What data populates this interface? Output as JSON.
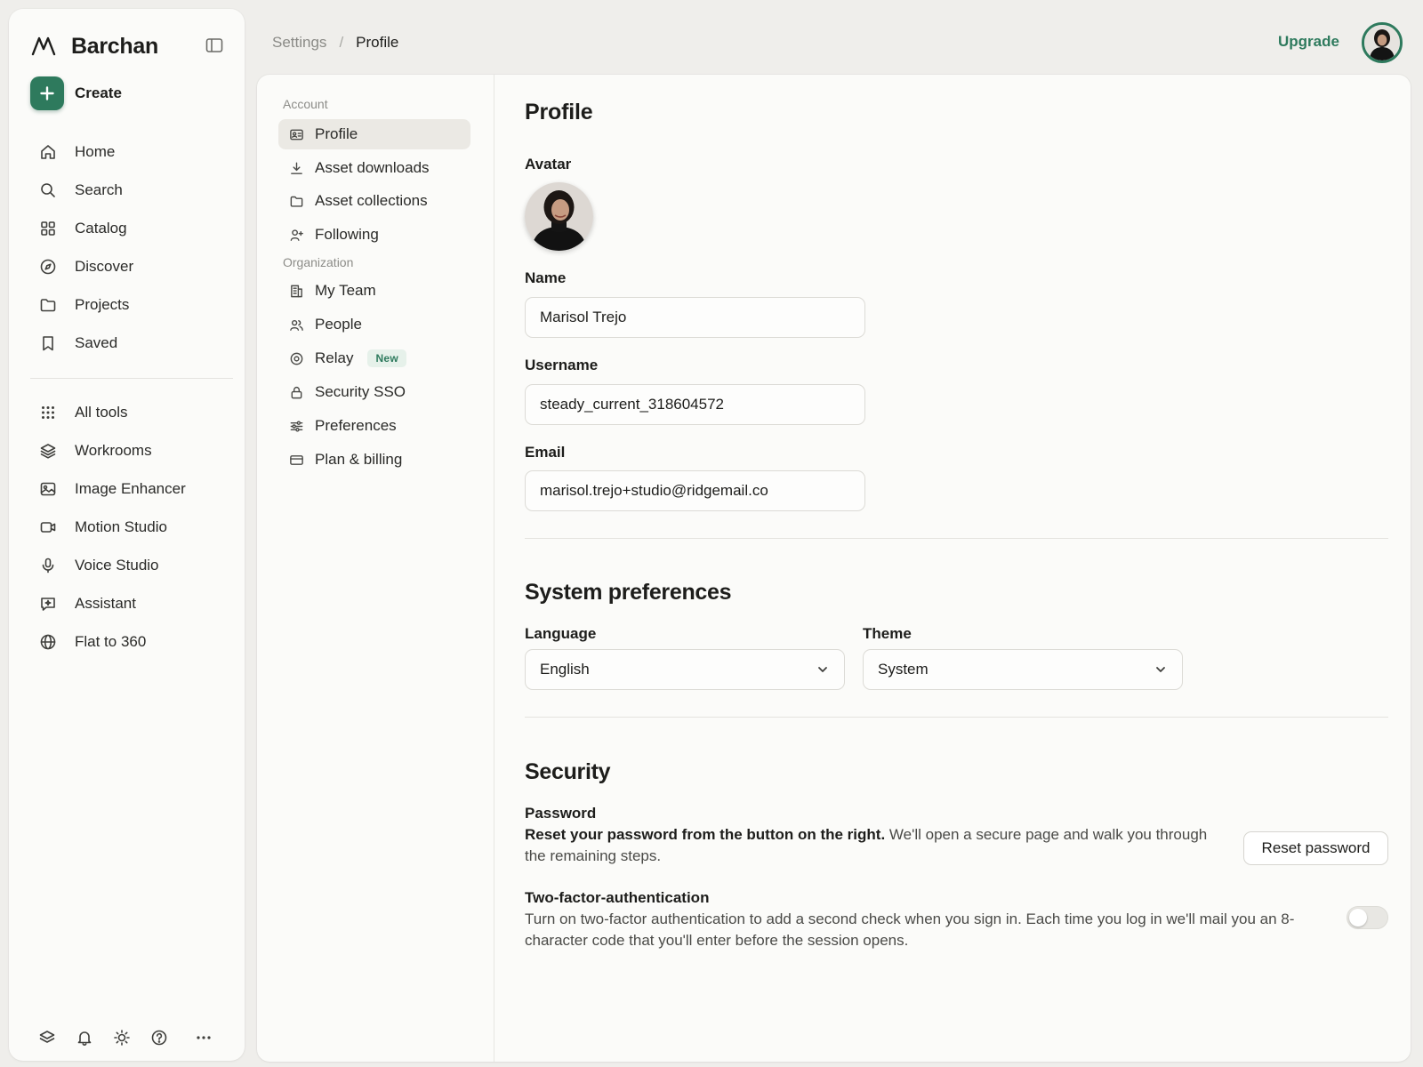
{
  "brand": {
    "name": "Barchan"
  },
  "sidebar": {
    "create_label": "Create",
    "primary": [
      {
        "label": "Home",
        "icon": "home-icon"
      },
      {
        "label": "Search",
        "icon": "search-icon"
      },
      {
        "label": "Catalog",
        "icon": "grid-icon"
      },
      {
        "label": "Discover",
        "icon": "compass-icon"
      },
      {
        "label": "Projects",
        "icon": "folder-icon"
      },
      {
        "label": "Saved",
        "icon": "bookmark-icon"
      }
    ],
    "tools": [
      {
        "label": "All tools",
        "icon": "dots-grid-icon"
      },
      {
        "label": "Workrooms",
        "icon": "layers-icon"
      },
      {
        "label": "Image Enhancer",
        "icon": "image-icon"
      },
      {
        "label": "Motion Studio",
        "icon": "video-icon"
      },
      {
        "label": "Voice Studio",
        "icon": "microphone-icon"
      },
      {
        "label": "Assistant",
        "icon": "chat-sparkle-icon"
      },
      {
        "label": "Flat to 360",
        "icon": "globe-icon"
      }
    ],
    "footer_icons": [
      "layers-icon",
      "bell-icon",
      "sun-icon",
      "help-icon",
      "more-icon"
    ]
  },
  "topbar": {
    "breadcrumb": {
      "parent": "Settings",
      "separator": "/",
      "current": "Profile"
    },
    "upgrade_label": "Upgrade"
  },
  "settings_nav": {
    "account_label": "Account",
    "account_items": [
      {
        "label": "Profile",
        "icon": "id-card-icon",
        "active": true
      },
      {
        "label": "Asset downloads",
        "icon": "download-icon"
      },
      {
        "label": "Asset collections",
        "icon": "folder-icon"
      },
      {
        "label": "Following",
        "icon": "user-plus-icon"
      }
    ],
    "organization_label": "Organization",
    "organization_items": [
      {
        "label": "My Team",
        "icon": "building-icon"
      },
      {
        "label": "People",
        "icon": "users-icon"
      },
      {
        "label": "Relay",
        "icon": "target-icon",
        "badge": "New"
      },
      {
        "label": "Security SSO",
        "icon": "lock-icon"
      },
      {
        "label": "Preferences",
        "icon": "sliders-icon"
      },
      {
        "label": "Plan & billing",
        "icon": "credit-card-icon"
      }
    ]
  },
  "profile": {
    "title": "Profile",
    "avatar_label": "Avatar",
    "name_label": "Name",
    "name_value": "Marisol Trejo",
    "username_label": "Username",
    "username_value": "steady_current_318604572",
    "email_label": "Email",
    "email_value": "marisol.trejo+studio@ridgemail.co"
  },
  "system_preferences": {
    "title": "System preferences",
    "language_label": "Language",
    "language_value": "English",
    "theme_label": "Theme",
    "theme_value": "System"
  },
  "security": {
    "title": "Security",
    "password_label": "Password",
    "password_bold": "Reset your password from the button on the right.",
    "password_text": " We'll open a secure page and walk you through the remaining steps.",
    "reset_button": "Reset password",
    "tfa_label": "Two-factor-authentication",
    "tfa_text": "Turn on two-factor authentication to add a second check when you sign in. Each time you log in we'll mail you an 8-character code that you'll enter before the session opens.",
    "tfa_enabled": false
  },
  "colors": {
    "accent": "#2e7a5d",
    "background": "#efeeeb",
    "surface": "#fbfbf9"
  }
}
